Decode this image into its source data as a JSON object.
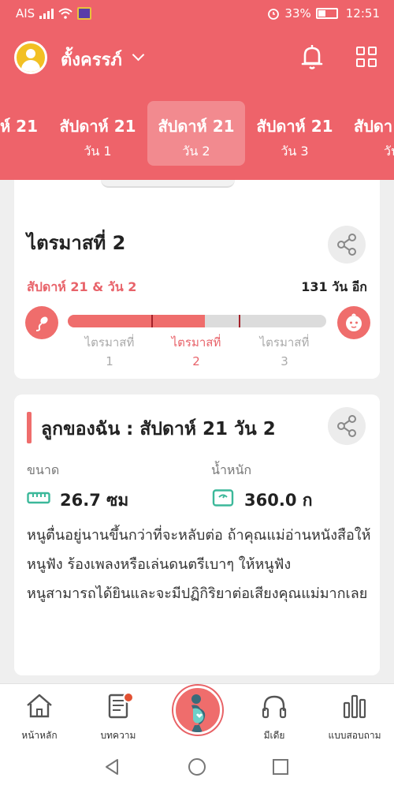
{
  "status_bar": {
    "carrier": "AIS",
    "battery": "33%",
    "time": "12:51"
  },
  "header": {
    "username": "ตั้งครรภ์",
    "icons": [
      "bell-icon",
      "grid-icon"
    ]
  },
  "week_tabs": [
    {
      "week": "ห์ 21",
      "day": ""
    },
    {
      "week": "สัปดาห์ 21",
      "day": "วัน 1"
    },
    {
      "week": "สัปดาห์ 21",
      "day": "วัน 2",
      "active": true
    },
    {
      "week": "สัปดาห์ 21",
      "day": "วัน 3"
    },
    {
      "week": "สัปดา",
      "day": "วัน"
    }
  ],
  "trimester_card": {
    "title": "ไตรมาสที่ 2",
    "week_day": "สัปดาห์ 21 & วัน 2",
    "days_left": "131 วัน อีก",
    "progress": 0.53,
    "labels": [
      {
        "text": "ไตรมาสที่",
        "num": "1"
      },
      {
        "text": "ไตรมาสที่",
        "num": "2"
      },
      {
        "text": "ไตรมาสที่",
        "num": "3"
      }
    ]
  },
  "baby_card": {
    "title": "ลูกของฉัน : สัปดาห์ 21 วัน 2",
    "size_label": "ขนาด",
    "size_value": "26.7 ซม",
    "weight_label": "น้ำหนัก",
    "weight_value": "360.0 ก",
    "description_1": "หนูตื่นอยู่นานขึ้นกว่าที่จะหลับต่อ ถ้าคุณแม่อ่านหนังสือให้หนูฟัง ร้องเพลงหรือเล่นดนตรีเบาๆ ให้หนูฟัง",
    "description_2": "หนูสามารถได้ยินและจะมีปฏิกิริยาต่อเสียงคุณแม่มากเลย"
  },
  "tab_bar": {
    "home": "หน้าหลัก",
    "articles": "บทความ",
    "media": "มีเดีย",
    "quiz": "แบบสอบถาม"
  },
  "colors": {
    "primary": "#ee636a",
    "accent_dark": "#a3222a"
  }
}
